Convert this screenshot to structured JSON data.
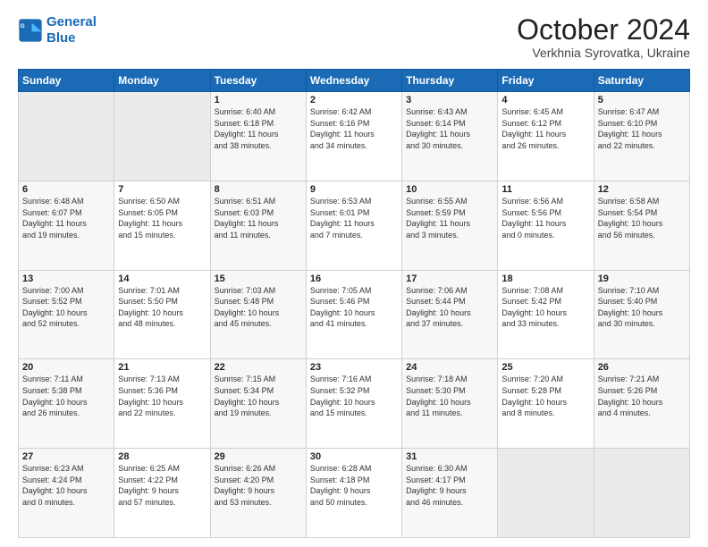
{
  "logo": {
    "line1": "General",
    "line2": "Blue"
  },
  "header": {
    "month": "October 2024",
    "location": "Verkhnia Syrovatka, Ukraine"
  },
  "days_header": [
    "Sunday",
    "Monday",
    "Tuesday",
    "Wednesday",
    "Thursday",
    "Friday",
    "Saturday"
  ],
  "weeks": [
    [
      {
        "num": "",
        "detail": ""
      },
      {
        "num": "",
        "detail": ""
      },
      {
        "num": "1",
        "detail": "Sunrise: 6:40 AM\nSunset: 6:18 PM\nDaylight: 11 hours\nand 38 minutes."
      },
      {
        "num": "2",
        "detail": "Sunrise: 6:42 AM\nSunset: 6:16 PM\nDaylight: 11 hours\nand 34 minutes."
      },
      {
        "num": "3",
        "detail": "Sunrise: 6:43 AM\nSunset: 6:14 PM\nDaylight: 11 hours\nand 30 minutes."
      },
      {
        "num": "4",
        "detail": "Sunrise: 6:45 AM\nSunset: 6:12 PM\nDaylight: 11 hours\nand 26 minutes."
      },
      {
        "num": "5",
        "detail": "Sunrise: 6:47 AM\nSunset: 6:10 PM\nDaylight: 11 hours\nand 22 minutes."
      }
    ],
    [
      {
        "num": "6",
        "detail": "Sunrise: 6:48 AM\nSunset: 6:07 PM\nDaylight: 11 hours\nand 19 minutes."
      },
      {
        "num": "7",
        "detail": "Sunrise: 6:50 AM\nSunset: 6:05 PM\nDaylight: 11 hours\nand 15 minutes."
      },
      {
        "num": "8",
        "detail": "Sunrise: 6:51 AM\nSunset: 6:03 PM\nDaylight: 11 hours\nand 11 minutes."
      },
      {
        "num": "9",
        "detail": "Sunrise: 6:53 AM\nSunset: 6:01 PM\nDaylight: 11 hours\nand 7 minutes."
      },
      {
        "num": "10",
        "detail": "Sunrise: 6:55 AM\nSunset: 5:59 PM\nDaylight: 11 hours\nand 3 minutes."
      },
      {
        "num": "11",
        "detail": "Sunrise: 6:56 AM\nSunset: 5:56 PM\nDaylight: 11 hours\nand 0 minutes."
      },
      {
        "num": "12",
        "detail": "Sunrise: 6:58 AM\nSunset: 5:54 PM\nDaylight: 10 hours\nand 56 minutes."
      }
    ],
    [
      {
        "num": "13",
        "detail": "Sunrise: 7:00 AM\nSunset: 5:52 PM\nDaylight: 10 hours\nand 52 minutes."
      },
      {
        "num": "14",
        "detail": "Sunrise: 7:01 AM\nSunset: 5:50 PM\nDaylight: 10 hours\nand 48 minutes."
      },
      {
        "num": "15",
        "detail": "Sunrise: 7:03 AM\nSunset: 5:48 PM\nDaylight: 10 hours\nand 45 minutes."
      },
      {
        "num": "16",
        "detail": "Sunrise: 7:05 AM\nSunset: 5:46 PM\nDaylight: 10 hours\nand 41 minutes."
      },
      {
        "num": "17",
        "detail": "Sunrise: 7:06 AM\nSunset: 5:44 PM\nDaylight: 10 hours\nand 37 minutes."
      },
      {
        "num": "18",
        "detail": "Sunrise: 7:08 AM\nSunset: 5:42 PM\nDaylight: 10 hours\nand 33 minutes."
      },
      {
        "num": "19",
        "detail": "Sunrise: 7:10 AM\nSunset: 5:40 PM\nDaylight: 10 hours\nand 30 minutes."
      }
    ],
    [
      {
        "num": "20",
        "detail": "Sunrise: 7:11 AM\nSunset: 5:38 PM\nDaylight: 10 hours\nand 26 minutes."
      },
      {
        "num": "21",
        "detail": "Sunrise: 7:13 AM\nSunset: 5:36 PM\nDaylight: 10 hours\nand 22 minutes."
      },
      {
        "num": "22",
        "detail": "Sunrise: 7:15 AM\nSunset: 5:34 PM\nDaylight: 10 hours\nand 19 minutes."
      },
      {
        "num": "23",
        "detail": "Sunrise: 7:16 AM\nSunset: 5:32 PM\nDaylight: 10 hours\nand 15 minutes."
      },
      {
        "num": "24",
        "detail": "Sunrise: 7:18 AM\nSunset: 5:30 PM\nDaylight: 10 hours\nand 11 minutes."
      },
      {
        "num": "25",
        "detail": "Sunrise: 7:20 AM\nSunset: 5:28 PM\nDaylight: 10 hours\nand 8 minutes."
      },
      {
        "num": "26",
        "detail": "Sunrise: 7:21 AM\nSunset: 5:26 PM\nDaylight: 10 hours\nand 4 minutes."
      }
    ],
    [
      {
        "num": "27",
        "detail": "Sunrise: 6:23 AM\nSunset: 4:24 PM\nDaylight: 10 hours\nand 0 minutes."
      },
      {
        "num": "28",
        "detail": "Sunrise: 6:25 AM\nSunset: 4:22 PM\nDaylight: 9 hours\nand 57 minutes."
      },
      {
        "num": "29",
        "detail": "Sunrise: 6:26 AM\nSunset: 4:20 PM\nDaylight: 9 hours\nand 53 minutes."
      },
      {
        "num": "30",
        "detail": "Sunrise: 6:28 AM\nSunset: 4:18 PM\nDaylight: 9 hours\nand 50 minutes."
      },
      {
        "num": "31",
        "detail": "Sunrise: 6:30 AM\nSunset: 4:17 PM\nDaylight: 9 hours\nand 46 minutes."
      },
      {
        "num": "",
        "detail": ""
      },
      {
        "num": "",
        "detail": ""
      }
    ]
  ]
}
